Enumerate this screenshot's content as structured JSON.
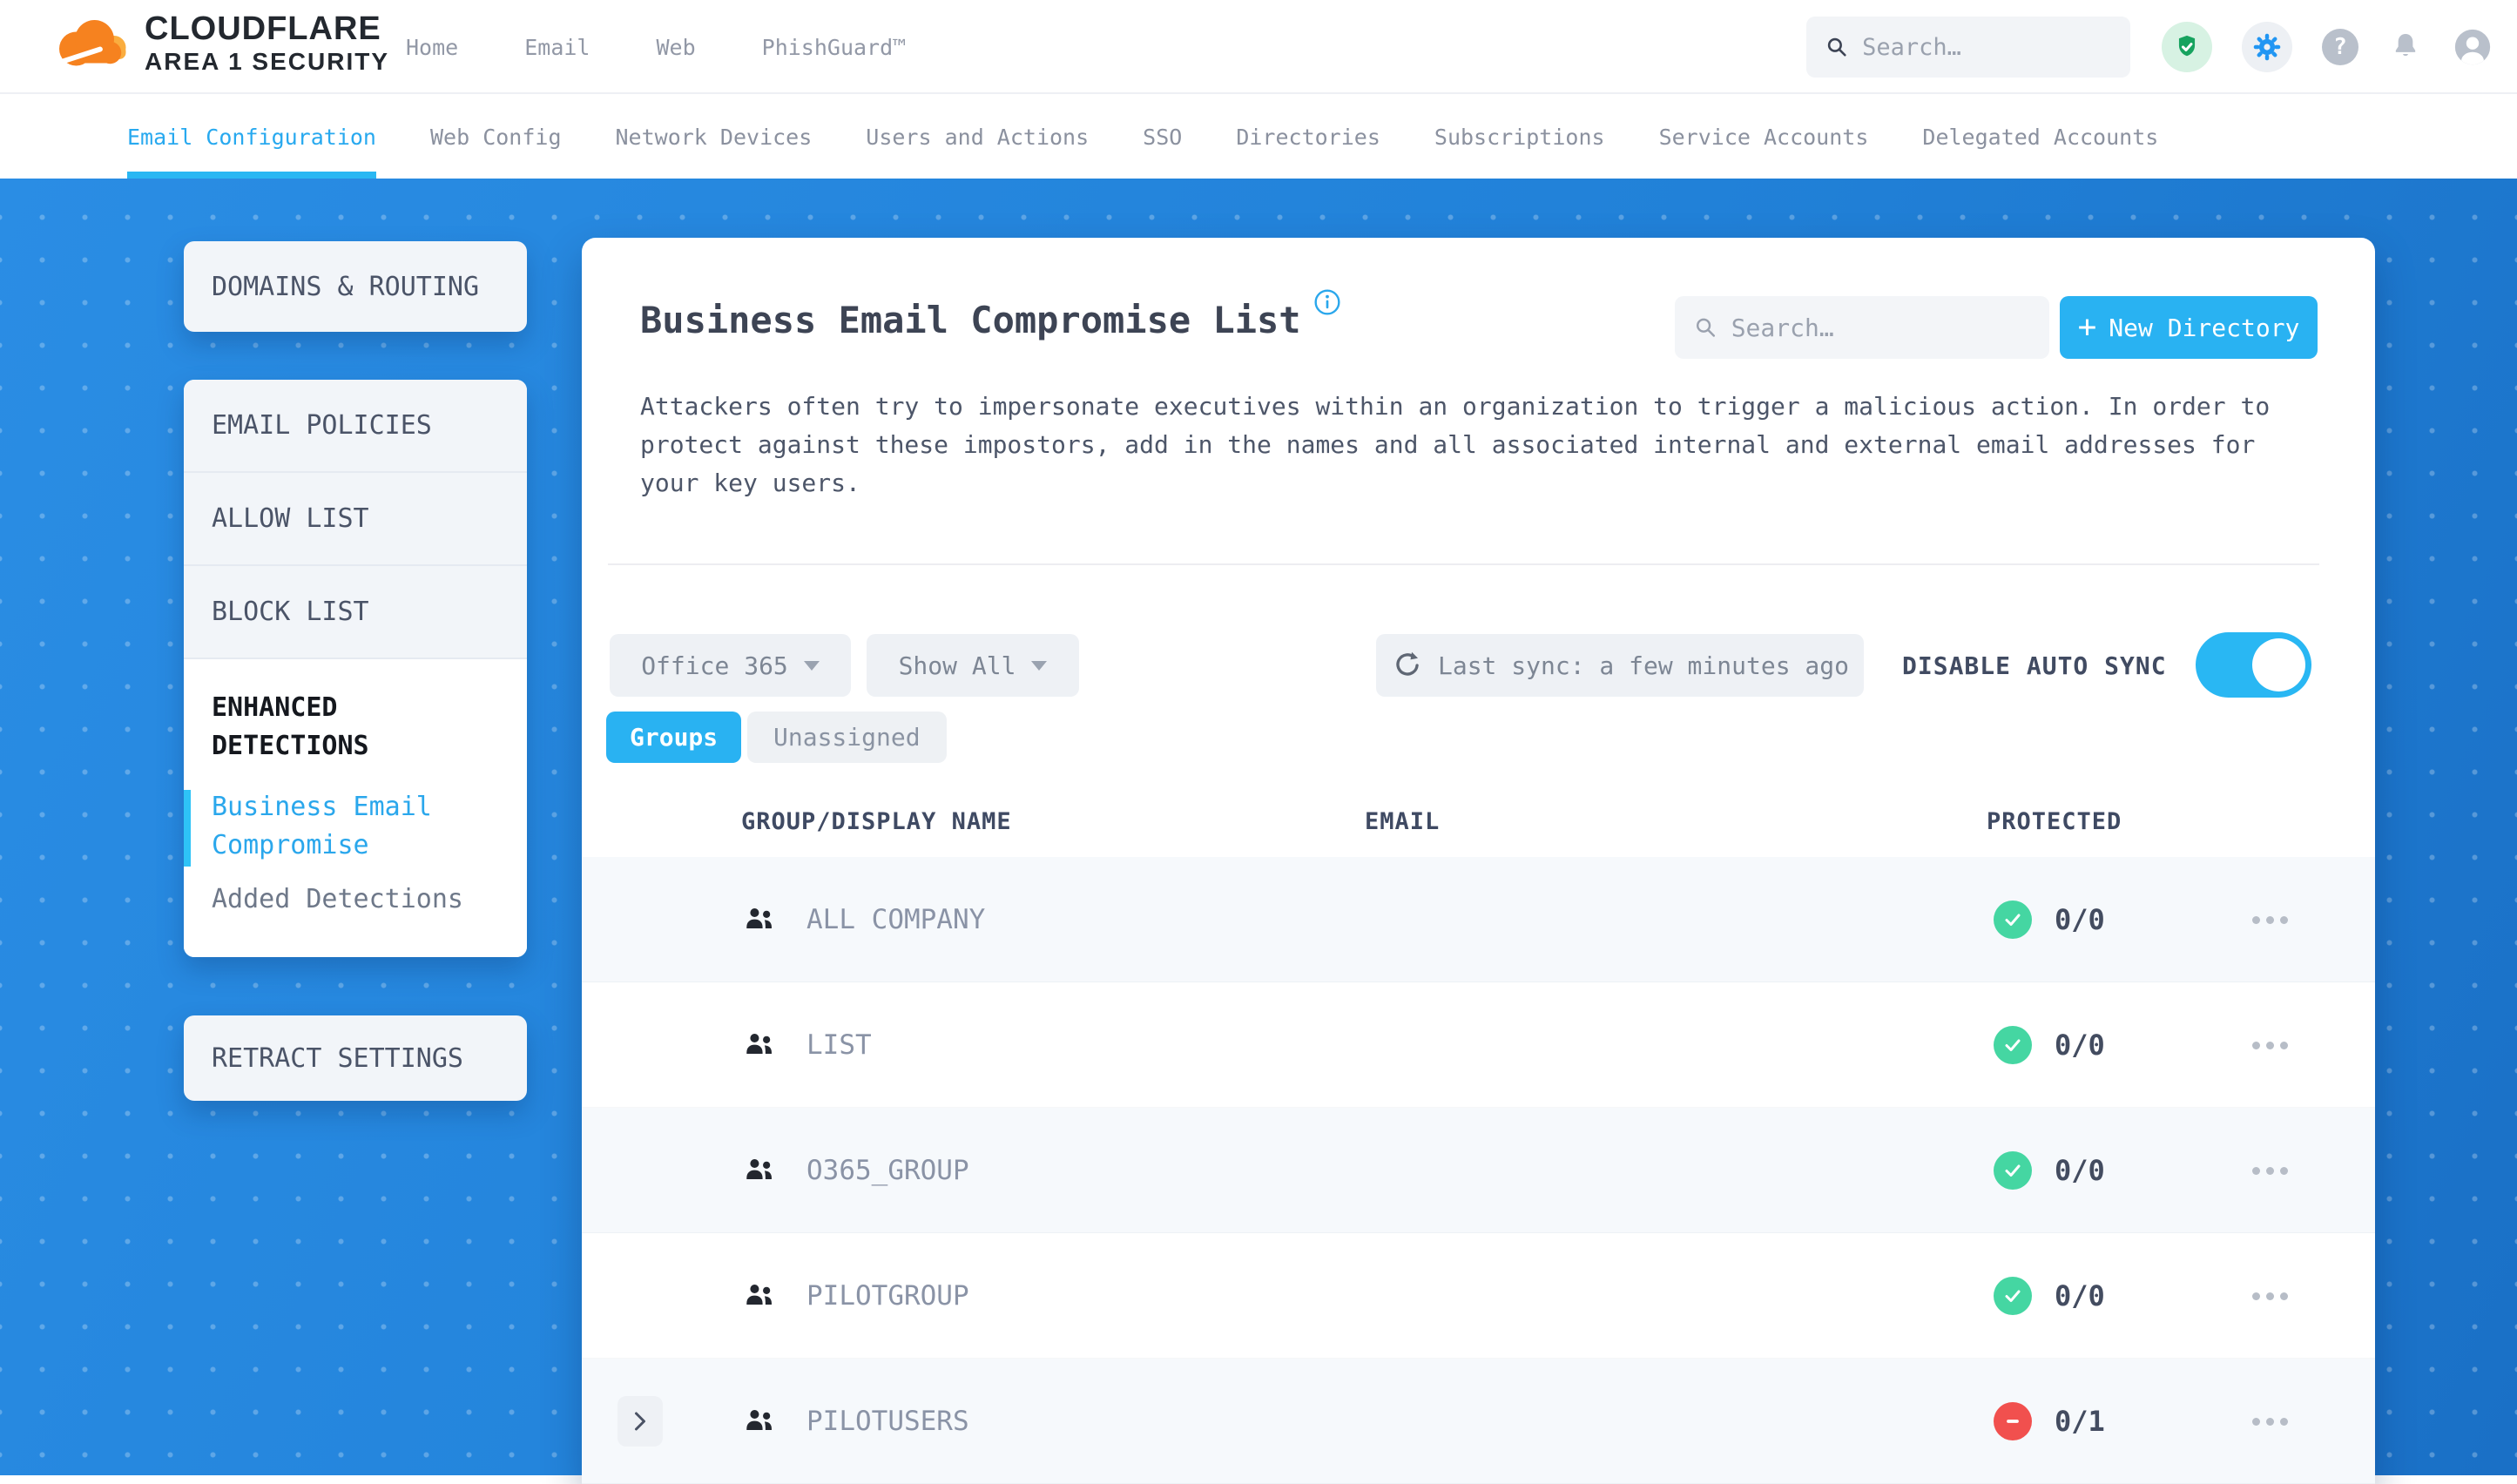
{
  "header": {
    "logo_line1": "CLOUDFLARE",
    "logo_line2": "AREA 1 SECURITY",
    "nav": {
      "home": "Home",
      "email": "Email",
      "web": "Web",
      "phishguard": "PhishGuard™"
    },
    "search_placeholder": "Search…",
    "help_glyph": "?"
  },
  "tabs": {
    "items": [
      {
        "label": "Email Configuration",
        "active": true
      },
      {
        "label": "Web Config"
      },
      {
        "label": "Network Devices"
      },
      {
        "label": "Users and Actions"
      },
      {
        "label": "SSO"
      },
      {
        "label": "Directories"
      },
      {
        "label": "Subscriptions"
      },
      {
        "label": "Service Accounts"
      },
      {
        "label": "Delegated Accounts"
      }
    ]
  },
  "sidebar": {
    "domains_routing": "DOMAINS & ROUTING",
    "email_policies": "EMAIL POLICIES",
    "allow_list": "ALLOW LIST",
    "block_list": "BLOCK LIST",
    "enhanced_detections": "ENHANCED DETECTIONS",
    "business_email_compromise": "Business Email Compromise",
    "added_detections": "Added Detections",
    "retract_settings": "RETRACT SETTINGS"
  },
  "main": {
    "title": "Business Email Compromise List",
    "search_placeholder": "Search…",
    "new_directory_plus": "+",
    "new_directory_label": "New Directory",
    "description": "Attackers often try to impersonate executives within an organization to trigger a malicious action. In order to protect against these impostors, add in the names and all associated internal and external email addresses for your key users.",
    "filters": {
      "directory": "Office 365",
      "show": "Show All",
      "last_sync": "Last sync: a few minutes ago",
      "auto_sync_label": "DISABLE AUTO SYNC",
      "auto_sync_on": true
    },
    "view_tabs": {
      "groups": "Groups",
      "unassigned": "Unassigned"
    },
    "table": {
      "headers": {
        "name": "GROUP/DISPLAY NAME",
        "email": "EMAIL",
        "protected": "PROTECTED"
      },
      "rows": [
        {
          "name": "ALL COMPANY",
          "email": "",
          "protected": "0/0",
          "status": "protected"
        },
        {
          "name": "LIST",
          "email": "",
          "protected": "0/0",
          "status": "protected"
        },
        {
          "name": "O365_GROUP",
          "email": "",
          "protected": "0/0",
          "status": "protected"
        },
        {
          "name": "PILOTGROUP",
          "email": "",
          "protected": "0/0",
          "status": "protected"
        },
        {
          "name": "PILOTUSERS",
          "email": "",
          "protected": "0/1",
          "status": "unprotected",
          "expandable": true
        }
      ]
    }
  },
  "colors": {
    "accent_blue": "#29b2f2",
    "link_blue": "#2aa7ec",
    "success_green": "#45d6a2",
    "danger_red": "#f1504e",
    "background_blue": "#2181d8"
  }
}
